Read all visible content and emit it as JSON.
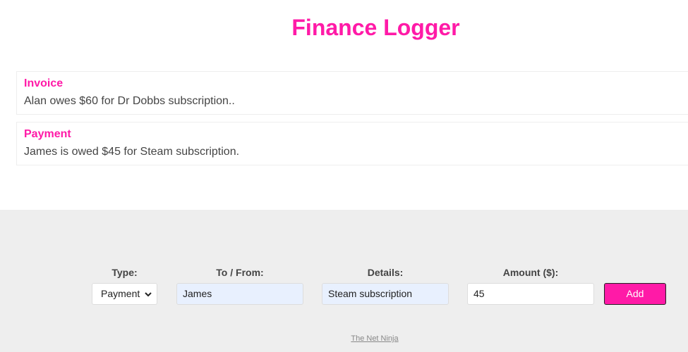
{
  "header": {
    "title": "Finance Logger"
  },
  "items": [
    {
      "type": "Invoice",
      "text": "Alan owes $60 for Dr Dobbs subscription.."
    },
    {
      "type": "Payment",
      "text": "James is owed $45 for Steam subscription."
    }
  ],
  "form": {
    "type": {
      "label": "Type:",
      "value": "Payment"
    },
    "tofrom": {
      "label": "To / From:",
      "value": "James"
    },
    "details": {
      "label": "Details:",
      "value": "Steam subscription"
    },
    "amount": {
      "label": "Amount ($):",
      "value": "45"
    },
    "add_label": "Add"
  },
  "footer": {
    "link_text": "The Net Ninja"
  },
  "colors": {
    "accent": "#ff1aa7",
    "footer_bg": "#eeeeee",
    "autofill_bg": "#e8f0fe"
  }
}
